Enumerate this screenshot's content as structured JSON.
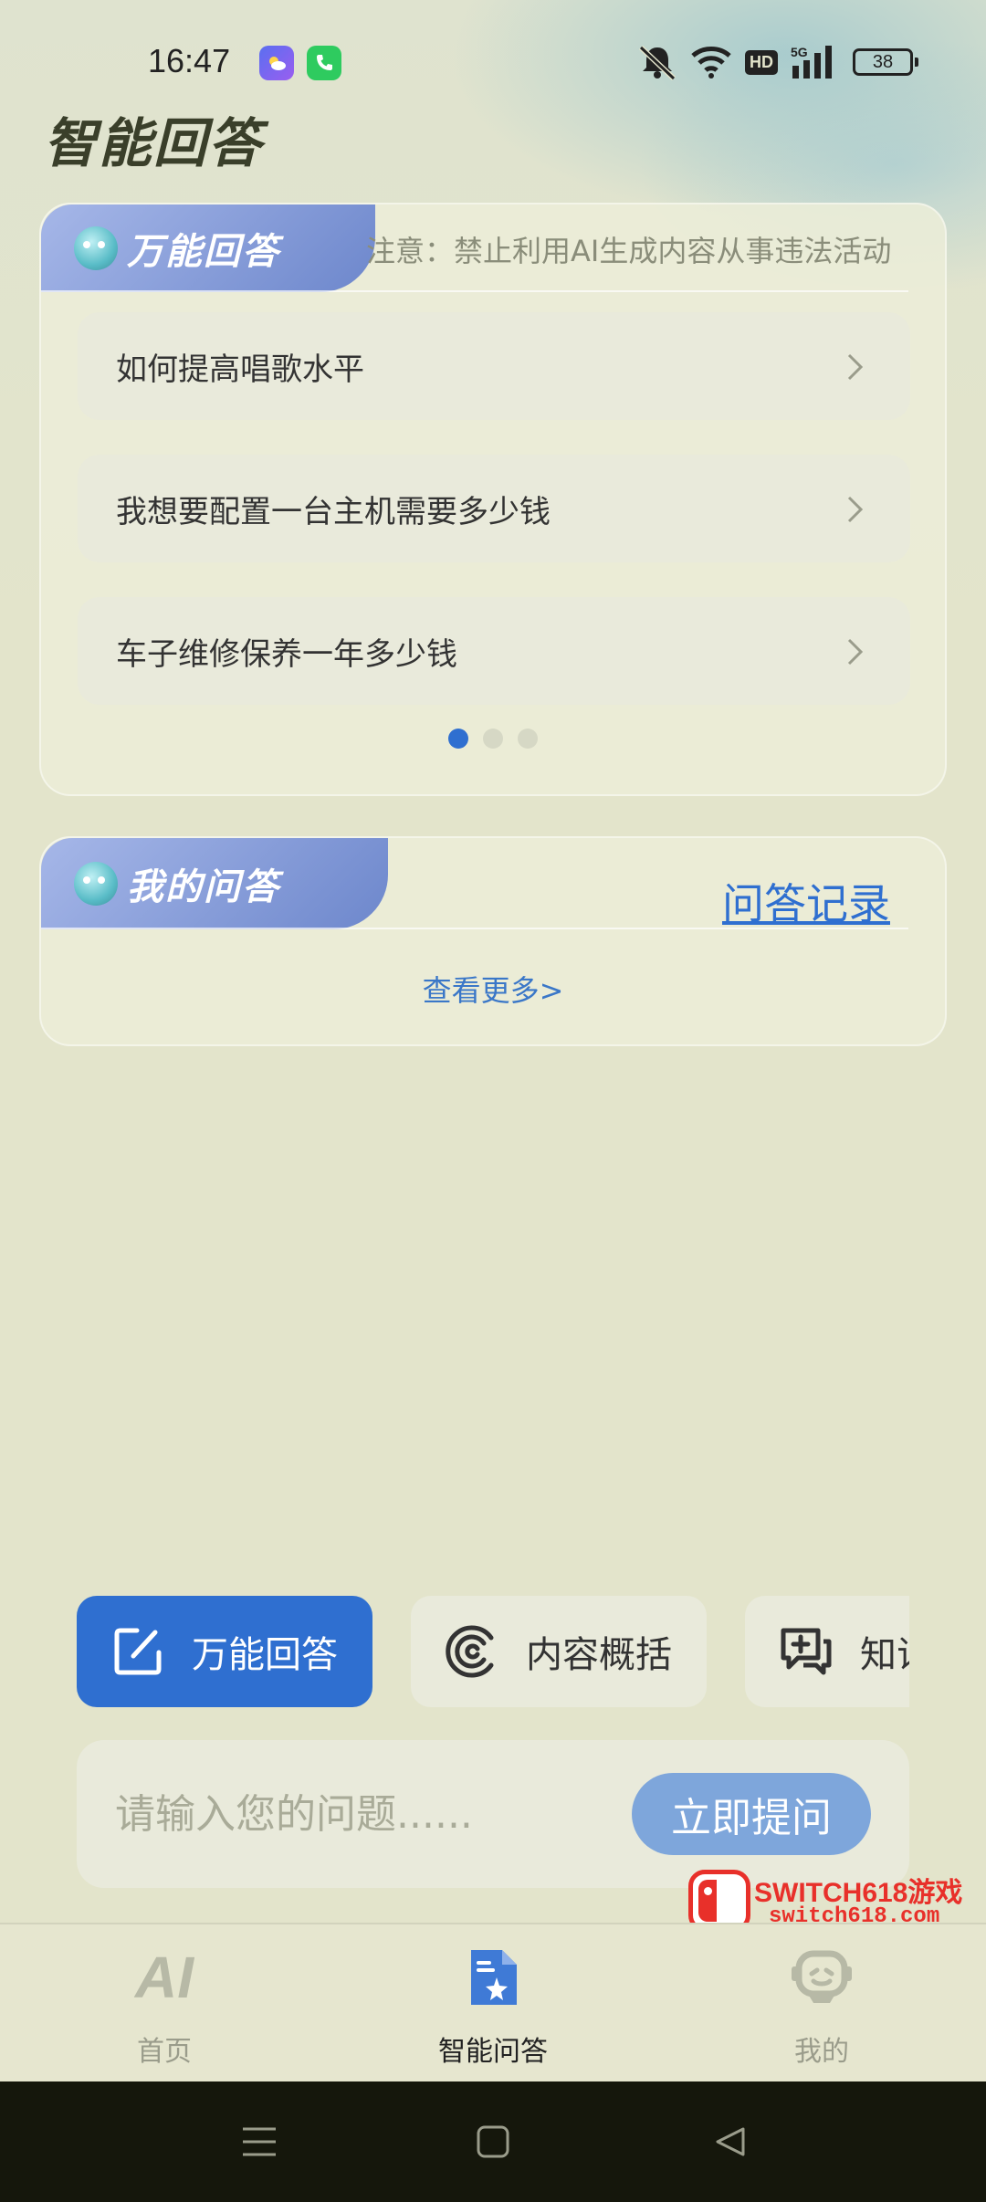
{
  "status_bar": {
    "time": "16:47",
    "hd": "HD",
    "network": "5G",
    "battery": "38",
    "icons": [
      "weather-app-icon",
      "phone-app-icon",
      "mute-icon",
      "wifi-icon",
      "signal-icon"
    ]
  },
  "page": {
    "title": "智能回答"
  },
  "qa_card": {
    "tab_title": "万能回答",
    "notice": "注意：禁止利用AI生成内容从事违法活动",
    "questions": [
      {
        "text": "如何提高唱歌水平"
      },
      {
        "text": "我想要配置一台主机需要多少钱"
      },
      {
        "text": "车子维修保养一年多少钱"
      }
    ],
    "pager": {
      "count": 3,
      "active": 0
    }
  },
  "my_qa_card": {
    "tab_title": "我的问答",
    "history_link": "问答记录",
    "see_more": "查看更多>"
  },
  "features": [
    {
      "label": "万能回答",
      "icon": "edit-icon",
      "active": true
    },
    {
      "label": "内容概括",
      "icon": "summary-icon",
      "active": false
    },
    {
      "label": "知识",
      "icon": "chat-plus-icon",
      "active": false
    }
  ],
  "input": {
    "placeholder": "请输入您的问题......",
    "value": "",
    "submit_label": "立即提问"
  },
  "watermark": {
    "title": "SWITCH618游戏",
    "url": "switch618.com"
  },
  "bottom_nav": {
    "items": [
      {
        "label": "首页",
        "icon_text": "AI",
        "active": false
      },
      {
        "label": "智能问答",
        "active": true
      },
      {
        "label": "我的",
        "active": false
      }
    ]
  },
  "colors": {
    "accent": "#2f6fd0",
    "background": "#e3e4cb",
    "card": "#e9eadb",
    "watermark": "#e8302a"
  }
}
